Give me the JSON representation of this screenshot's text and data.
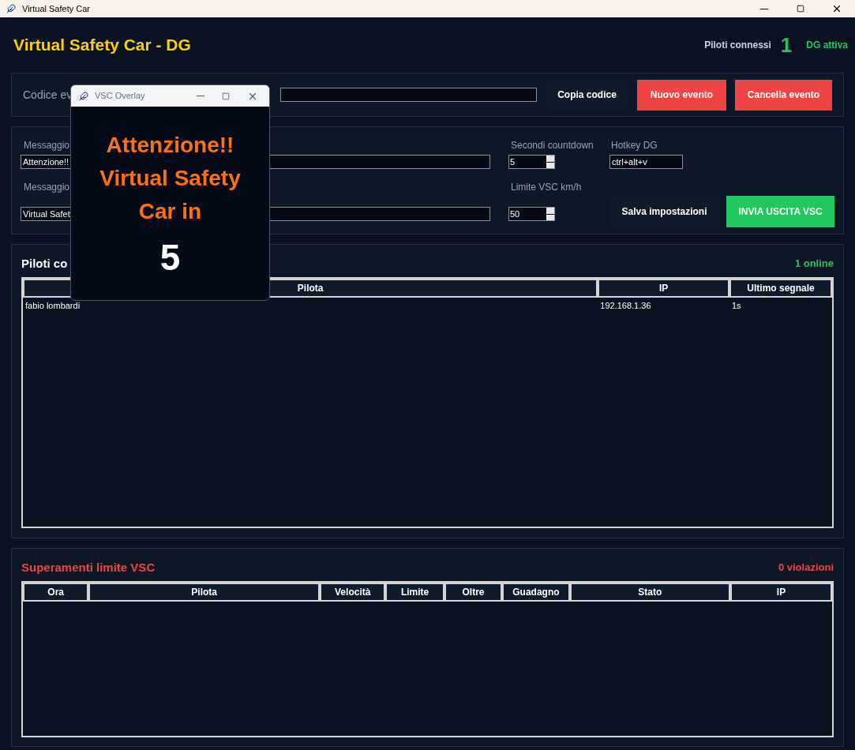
{
  "window": {
    "title": "Virtual Safety Car"
  },
  "header": {
    "title": "Virtual Safety Car - DG",
    "connected_label": "Piloti connessi",
    "connected_count": "1",
    "status": "DG attiva"
  },
  "event": {
    "label": "Codice ev",
    "buttons": [
      {
        "label": "Copia codice",
        "kind": "neutral"
      },
      {
        "label": "Nuovo evento",
        "kind": "danger"
      },
      {
        "label": "Cancella evento",
        "kind": "danger"
      }
    ]
  },
  "settings": {
    "message_1": {
      "label": "Messaggio",
      "value": "Attenzione!!"
    },
    "message_2": {
      "label": "Messaggio",
      "value": "Virtual Safet"
    },
    "countdown": {
      "label": "Secondi countdown",
      "value": "5"
    },
    "hotkey": {
      "label": "Hotkey DG",
      "value": "ctrl+alt+v"
    },
    "limit": {
      "label": "Limite VSC km/h",
      "value": "50"
    },
    "buttons": [
      {
        "label": "Salva impostazioni",
        "kind": "neutral"
      },
      {
        "label": "INVIA USCITA VSC",
        "kind": "success"
      }
    ]
  },
  "pilots": {
    "title": "Piloti co",
    "count": "1 online",
    "columns": [
      "Pilota",
      "IP",
      "Ultimo segnale"
    ],
    "rows": [
      [
        "fabio lombardi",
        "192.168.1.36",
        "1s"
      ]
    ]
  },
  "violations": {
    "title": "Superamenti limite VSC",
    "count": "0 violazioni",
    "columns": [
      "Ora",
      "Pilota",
      "Velocità",
      "Limite",
      "Oltre",
      "Guadagno",
      "Stato",
      "IP"
    ]
  },
  "overlay": {
    "title": "VSC Overlay",
    "lines": [
      "Attenzione!!",
      "Virtual Safety",
      "Car in"
    ],
    "countdown": "5"
  }
}
